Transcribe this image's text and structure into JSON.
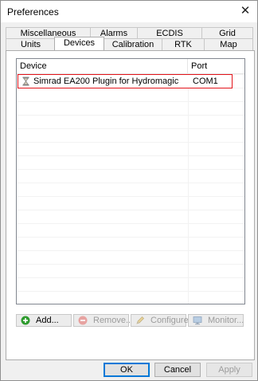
{
  "window": {
    "title": "Preferences"
  },
  "tabs_back": [
    "Miscellaneous",
    "Alarms",
    "ECDIS",
    "Grid"
  ],
  "tabs_front": [
    "Units",
    "Devices",
    "Calibration",
    "RTK",
    "Map"
  ],
  "active_tab": "Devices",
  "device_list": {
    "columns": [
      "Device",
      "Port"
    ],
    "rows": [
      {
        "device": "Simrad EA200 Plugin for Hydromagic",
        "port": "COM1",
        "selected": true
      }
    ]
  },
  "list_buttons": {
    "add": "Add...",
    "remove": "Remove...",
    "configure": "Configure...",
    "monitor": "Monitor..."
  },
  "dialog_buttons": {
    "ok": "OK",
    "cancel": "Cancel",
    "apply": "Apply"
  },
  "colors": {
    "selection_border": "#e3141b",
    "default_button_border": "#0078d7",
    "add_icon": "#2e9b2e",
    "remove_icon": "#d9534f"
  }
}
